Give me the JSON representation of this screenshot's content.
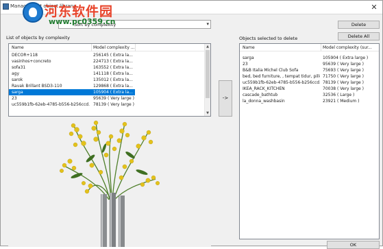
{
  "window": {
    "title": "Management object library",
    "close_glyph": "✕"
  },
  "watermark": {
    "site_name": "河东软件园",
    "url": "www.pc0359.cn"
  },
  "sort": {
    "selected": "Sort by complexity",
    "arrow": "▾"
  },
  "left_panel": {
    "label": "List of objects by complexity",
    "columns": [
      "Name",
      "Model complexity ..."
    ],
    "rows": [
      {
        "name": "DECOR+118",
        "complexity": "256145 ( Extra la..."
      },
      {
        "name": "vasinhos+concreto",
        "complexity": "224713 ( Extra la..."
      },
      {
        "name": "sofa31",
        "complexity": "163552 ( Extra la..."
      },
      {
        "name": "agy",
        "complexity": "141118 ( Extra la..."
      },
      {
        "name": "sarok",
        "complexity": "135012 ( Extra la..."
      },
      {
        "name": "Ravak Brillant BSD3-110",
        "complexity": "129868 ( Extra la..."
      },
      {
        "name": "sarga",
        "complexity": "105904 ( Extra la...",
        "selected": true
      },
      {
        "name": "23",
        "complexity": "95639 ( Very large )"
      },
      {
        "name": "uc559b1fb-62eb-4785-b556-b256ccd...",
        "complexity": "78139 ( Very large )"
      }
    ]
  },
  "move_button": "->",
  "right_panel": {
    "label": "Objects selected to delete",
    "columns": [
      "Name",
      "Model complexity (sur..."
    ],
    "rows": [
      {
        "name": "sarga",
        "complexity": "105904 ( Extra large )"
      },
      {
        "name": "23",
        "complexity": "95639 ( Very large )"
      },
      {
        "name": "B&B Italia Michel Club Sofa",
        "complexity": "75693 ( Very large )"
      },
      {
        "name": "bed, bed furniture, , tempat tidur, pillow",
        "complexity": "71750 ( Very large )"
      },
      {
        "name": "uc559b1fb-62eb-4785-b556-b256ccd...",
        "complexity": "78139 ( Very large )"
      },
      {
        "name": "IKEA_RACK_KITCHEN",
        "complexity": "70038 ( Very large )"
      },
      {
        "name": "cascade_bathtub",
        "complexity": "32536 ( Large )"
      },
      {
        "name": "la_donna_washbasin",
        "complexity": "23921 ( Medium )"
      }
    ]
  },
  "buttons": {
    "delete": "Delete",
    "delete_all": "Delete All",
    "ok": "OK"
  },
  "icons": {
    "close": "close-icon",
    "dropdown": "chevron-down-icon",
    "scroll_up": "scroll-up-icon",
    "scroll_down": "scroll-down-icon"
  }
}
